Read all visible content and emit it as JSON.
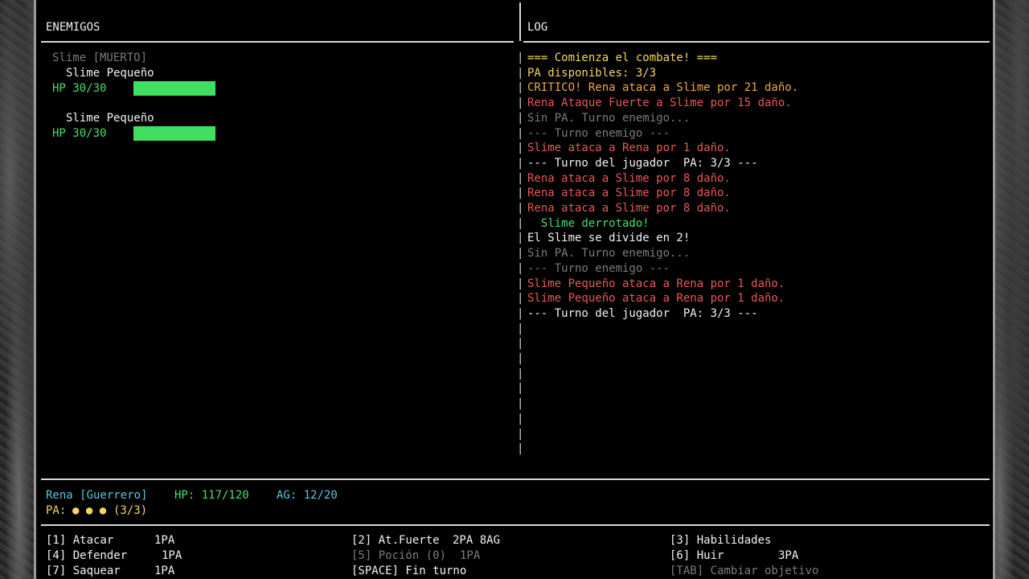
{
  "enemies_panel": {
    "title": "ENEMIGOS",
    "dead": "Slime [MUERTO]",
    "list": [
      {
        "name": "Slime Pequeño",
        "hp_text": "HP 30/30",
        "hp_fraction": 1.0
      },
      {
        "name": "Slime Pequeño",
        "hp_text": "HP 30/30",
        "hp_fraction": 1.0
      }
    ]
  },
  "log_panel": {
    "title": "LOG",
    "entries": [
      {
        "text": "=== Comienza el combate! ===",
        "color": "yellow"
      },
      {
        "text": "PA disponibles: 3/3",
        "color": "yellow"
      },
      {
        "text": "CRITICO! Rena ataca a Slime por 21 daño.",
        "color": "orange"
      },
      {
        "text": "Rena Ataque Fuerte a Slime por 15 daño.",
        "color": "red"
      },
      {
        "text": "Sin PA. Turno enemigo...",
        "color": "gray"
      },
      {
        "text": "--- Turno enemigo ---",
        "color": "gray"
      },
      {
        "text": "Slime ataca a Rena por 1 daño.",
        "color": "red"
      },
      {
        "text": "--- Turno del jugador  PA: 3/3 ---",
        "color": "white"
      },
      {
        "text": "Rena ataca a Slime por 8 daño.",
        "color": "red"
      },
      {
        "text": "Rena ataca a Slime por 8 daño.",
        "color": "red"
      },
      {
        "text": "Rena ataca a Slime por 8 daño.",
        "color": "red"
      },
      {
        "text": "  Slime derrotado!",
        "color": "green"
      },
      {
        "text": "El Slime se divide en 2!",
        "color": "white"
      },
      {
        "text": "Sin PA. Turno enemigo...",
        "color": "gray"
      },
      {
        "text": "--- Turno enemigo ---",
        "color": "gray"
      },
      {
        "text": "Slime Pequeño ataca a Rena por 1 daño.",
        "color": "red"
      },
      {
        "text": "Slime Pequeño ataca a Rena por 1 daño.",
        "color": "red"
      },
      {
        "text": "--- Turno del jugador  PA: 3/3 ---",
        "color": "white"
      }
    ]
  },
  "status": {
    "name": "Rena [Guerrero]",
    "hp": "HP: 117/120",
    "ag": "AG: 12/20",
    "pa_label": "PA:",
    "pa_dots": "● ● ●",
    "pa_count": "(3/3)"
  },
  "actions": {
    "atacar": {
      "key": "[1] Atacar",
      "cost": "1PA"
    },
    "fuerte": {
      "key": "[2] At.Fuerte",
      "cost": "2PA 8AG"
    },
    "habilidades": {
      "key": "[3] Habilidades"
    },
    "defender": {
      "key": "[4] Defender",
      "cost": "1PA"
    },
    "pocion": {
      "key": "[5] Poción (0)",
      "cost": "1PA"
    },
    "huir": {
      "key": "[6] Huir",
      "cost": "3PA"
    },
    "saquear": {
      "key": "[7] Saquear",
      "cost": "1PA"
    },
    "fin_turno": {
      "key": "[SPACE] Fin turno"
    },
    "cambiar": {
      "key": "[TAB] Cambiar objetivo"
    }
  },
  "colors": {
    "background": "#000000",
    "hp_bar": "#3fe060",
    "text_white": "#f2f2f2",
    "text_gray": "#7c7c7c",
    "text_green": "#4ade6a",
    "text_red": "#e85858",
    "text_yellow": "#f2d860",
    "text_orange": "#f0a848",
    "text_cyan": "#5cc6e0"
  }
}
